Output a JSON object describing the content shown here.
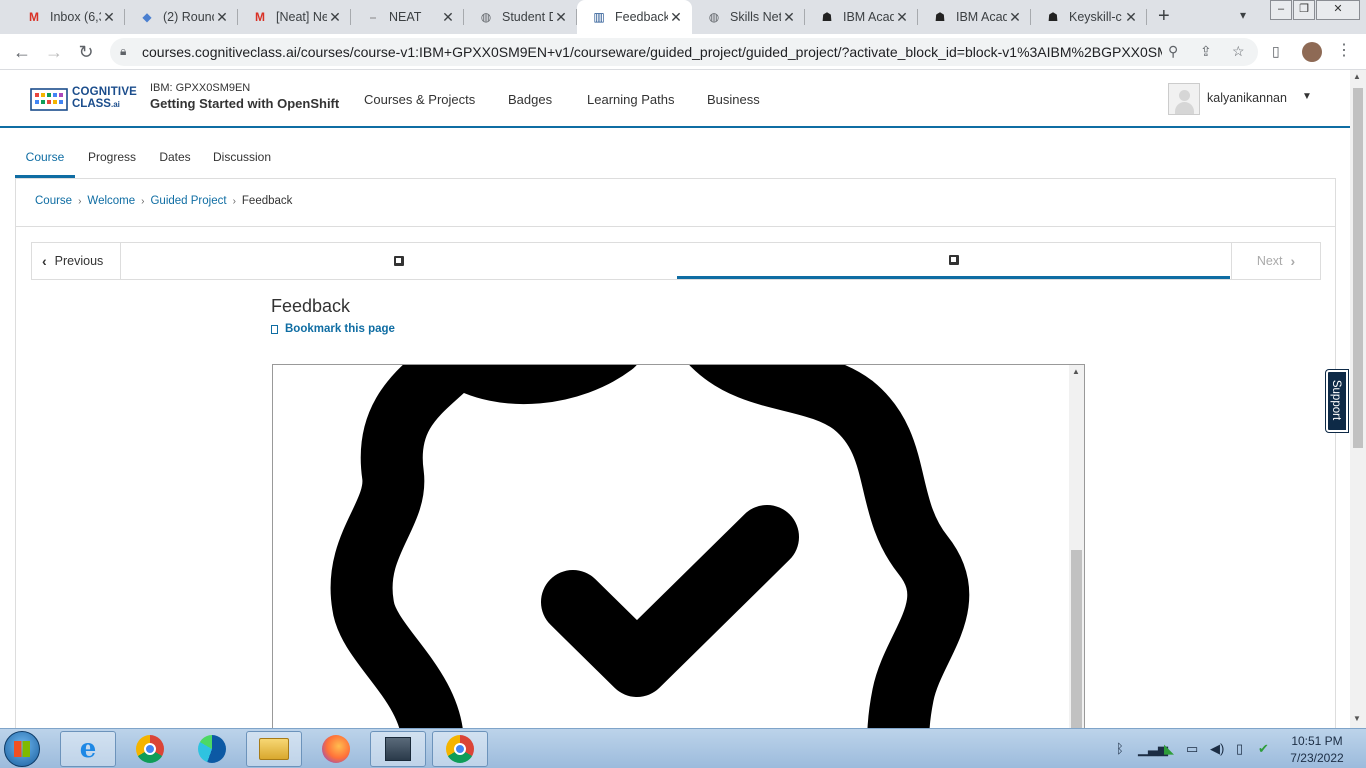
{
  "browser": {
    "tabs": [
      {
        "title": "Inbox (6,3",
        "icon": "gmail-icon",
        "color": "#d93025"
      },
      {
        "title": "(2) Round",
        "icon": "app-icon",
        "color": "#4a7fd0"
      },
      {
        "title": "[Neat] Ne",
        "icon": "gmail-icon",
        "color": "#d93025"
      },
      {
        "title": "NEAT",
        "icon": "neat-icon",
        "color": "#888888"
      },
      {
        "title": "Student D",
        "icon": "globe-icon",
        "color": "#5f6368"
      },
      {
        "title": "Feedback",
        "icon": "cognitiveclass-icon",
        "color": "#1b4d8c"
      },
      {
        "title": "Skills Net",
        "icon": "globe-icon",
        "color": "#5f6368"
      },
      {
        "title": "IBM Acad",
        "icon": "ibm-icon",
        "color": "#222222"
      },
      {
        "title": "IBM Acad",
        "icon": "ibm-icon",
        "color": "#222222"
      },
      {
        "title": "Keyskill-c",
        "icon": "ibm-icon",
        "color": "#222222"
      }
    ],
    "url": "courses.cognitiveclass.ai/courses/course-v1:IBM+GPXX0SM9EN+v1/courseware/guided_project/guided_project/?activate_block_id=block-v1%3AIBM%2BGPXX0SM..."
  },
  "header": {
    "logo_line1": "COGNITIVE",
    "logo_line2": "CLASS",
    "logo_suffix": ".ai",
    "course_code": "IBM: GPXX0SM9EN",
    "course_title": "Getting Started with OpenShift",
    "nav": [
      "Courses & Projects",
      "Badges",
      "Learning Paths",
      "Business"
    ],
    "username": "kalyanikannan"
  },
  "course_tabs": [
    "Course",
    "Progress",
    "Dates",
    "Discussion"
  ],
  "breadcrumb": [
    "Course",
    "Welcome",
    "Guided Project",
    "Feedback"
  ],
  "sequence": {
    "previous_label": "Previous",
    "next_label": "Next"
  },
  "unit": {
    "title": "Feedback",
    "bookmark_label": "Bookmark this page"
  },
  "support_label": "Support",
  "taskbar": {
    "time": "10:51 PM",
    "date": "7/23/2022"
  },
  "colors": {
    "brand_blue": "#0f6da3",
    "support_bg": "#0e2a47"
  }
}
